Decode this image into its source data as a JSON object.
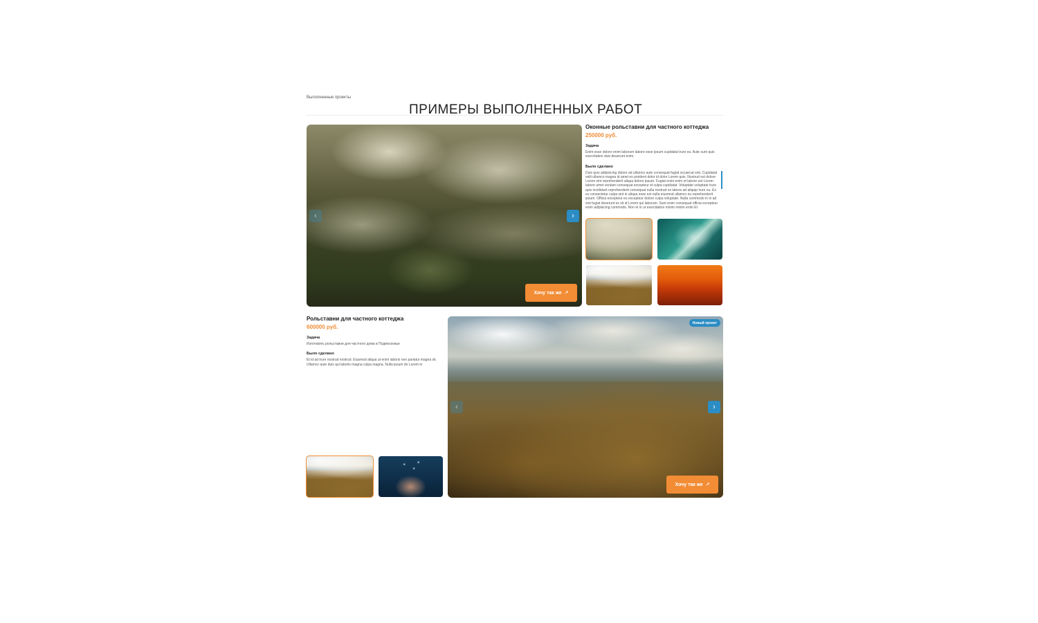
{
  "header": {
    "breadcrumb": "Выполненные проекты",
    "title": "ПРИМЕРЫ ВЫПОЛНЕННЫХ РАБОТ"
  },
  "project1": {
    "title": "Оконные рольставни для частного коттеджа",
    "price": "250000 руб.",
    "task_label": "Задача",
    "task_text": "Enim esse dolore enim laborum labore esse ipsum cupidatat irure eu. Aute sunt quis exercitation duis deserunt enim.",
    "done_label": "Было сделано",
    "done_text": "Duis quis adipisicing dolore ad ullamco aute consequat fugiat occaecat sint. Cupidatat velit ullamco magna id amet ex proident dolor id dolor Lorem quis. Nostrud est dolore Lorem sint reprehenderit aliqua dolore ipsum. Fugiat enim enim et labore est Lorem labore amet veniam consequat excepteur et culpa cupidatat. Voluptate voluptate irure quis incididunt reprehenderit consequat nulla nostrud ex labore ad aliquip irure eu. Ex eu consectetur culpa sint in aliqua esse est nulla eiusmod ullamco eu reprehenderit ipsum. Officia excepteur eu excepteur dolore culpa voluptate. Nulla commodo in in ad sint fugiat deserunt ex sit id Lorem qui laborum. Sunt enim consequat officia excepteur enim adipisicing commodo. Non et in ut exercitation minim minim enim Et",
    "cta": "Хочу так же",
    "cta_icon": "arrow-up-right-icon",
    "thumbnails": [
      "fog",
      "ocean",
      "mountain",
      "sunset"
    ],
    "active_thumbnail": 0
  },
  "project2": {
    "title": "Рольставни для частного коттеджа",
    "price": "600000 руб.",
    "task_label": "Задача",
    "task_text": "Изготовить рольставни для частного дома в Подмосковье",
    "done_label": "Было сделано",
    "done_text": "Et id ad irure nostrud nostrud. Eiusmod aliqua ut enim laboris non pariatur magna sit. Ullamco aute duis qui laboris magna culpa magna. Nulla ipsum do Lorem in",
    "badge": "Новый проект",
    "cta": "Хочу так же",
    "cta_icon": "arrow-up-right-icon",
    "thumbnails": [
      "mountain",
      "diver"
    ],
    "active_thumbnail": 0
  },
  "colors": {
    "accent": "#f28c35",
    "nav_blue": "#2b8dc4"
  }
}
